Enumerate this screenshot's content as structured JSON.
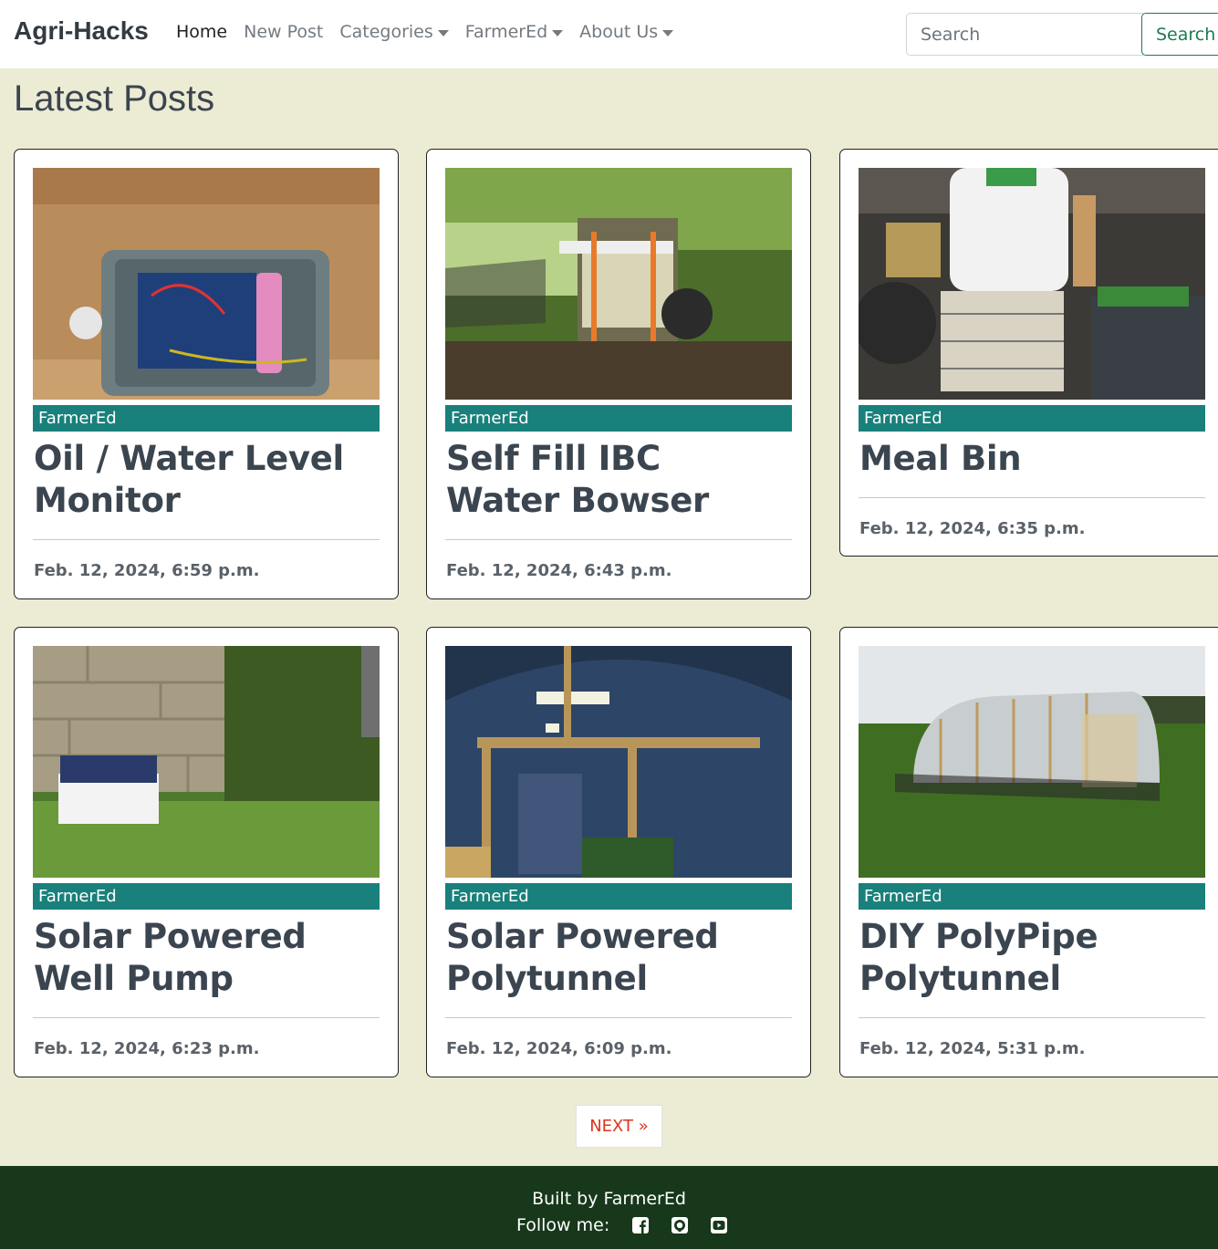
{
  "nav": {
    "brand": "Agri-Hacks",
    "links": [
      {
        "label": "Home",
        "dropdown": false,
        "active": true
      },
      {
        "label": "New Post",
        "dropdown": false,
        "active": false
      },
      {
        "label": "Categories",
        "dropdown": true,
        "active": false
      },
      {
        "label": "FarmerEd",
        "dropdown": true,
        "active": false
      },
      {
        "label": "About Us",
        "dropdown": true,
        "active": false
      }
    ],
    "search_placeholder": "Search",
    "search_button": "Search"
  },
  "page_title": "Latest Posts",
  "posts": [
    {
      "category": "FarmerEd",
      "title": "Oil / Water Level Monitor",
      "date": "Feb. 12, 2024, 6:59 p.m.",
      "image": "electronics-box-photo"
    },
    {
      "category": "FarmerEd",
      "title": "Self Fill IBC Water Bowser",
      "date": "Feb. 12, 2024, 6:43 p.m.",
      "image": "ibc-trailer-photo"
    },
    {
      "category": "FarmerEd",
      "title": "Meal Bin",
      "date": "Feb. 12, 2024, 6:35 p.m.",
      "image": "meal-bin-photo"
    },
    {
      "category": "FarmerEd",
      "title": "Solar Powered Well Pump",
      "date": "Feb. 12, 2024, 6:23 p.m.",
      "image": "solar-panel-wall-photo"
    },
    {
      "category": "FarmerEd",
      "title": "Solar Powered Polytunnel",
      "date": "Feb. 12, 2024, 6:09 p.m.",
      "image": "polytunnel-interior-photo"
    },
    {
      "category": "FarmerEd",
      "title": "DIY PolyPipe Polytunnel",
      "date": "Feb. 12, 2024, 5:31 p.m.",
      "image": "polytunnel-field-photo"
    }
  ],
  "pagination": {
    "next_label": "NEXT »"
  },
  "footer": {
    "built_by": "Built by FarmerEd",
    "follow_label": "Follow me:",
    "socials": [
      "facebook-icon",
      "github-icon",
      "youtube-icon"
    ]
  },
  "colors": {
    "background": "#ecebd4",
    "badge": "#19807b",
    "footer": "#17381a",
    "next": "#d9361f",
    "search_button": "#1e7a52"
  }
}
